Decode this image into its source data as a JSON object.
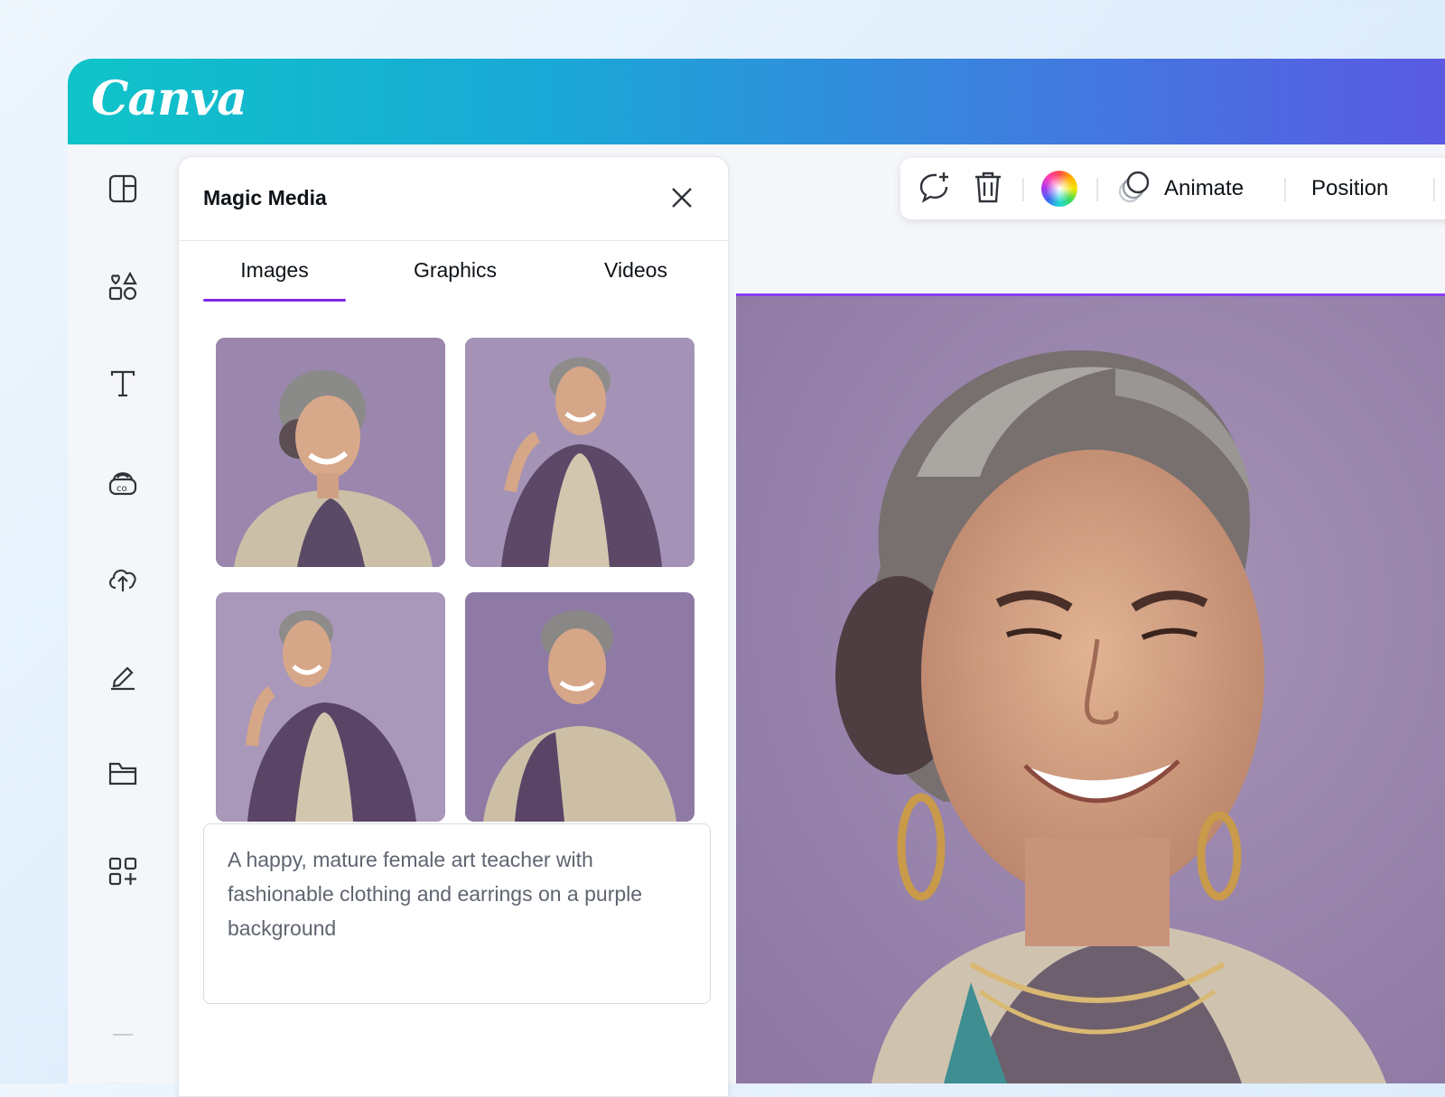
{
  "brand": {
    "logo_text": "Canva",
    "accent": "#7d2ae8"
  },
  "sidebar": {
    "items": [
      {
        "name": "design-icon"
      },
      {
        "name": "elements-icon"
      },
      {
        "name": "text-icon"
      },
      {
        "name": "brand-icon"
      },
      {
        "name": "uploads-icon"
      },
      {
        "name": "draw-icon"
      },
      {
        "name": "projects-icon"
      },
      {
        "name": "apps-icon"
      }
    ],
    "magic_media_icon": "magic-media-icon"
  },
  "panel": {
    "title": "Magic Media",
    "tabs": [
      {
        "label": "Images",
        "active": true
      },
      {
        "label": "Graphics",
        "active": false
      },
      {
        "label": "Videos",
        "active": false
      }
    ],
    "prompt_text": "A happy, mature female art teacher with fashionable clothing and earrings on a purple background"
  },
  "toolbar": {
    "animate_label": "Animate",
    "position_label": "Position"
  }
}
